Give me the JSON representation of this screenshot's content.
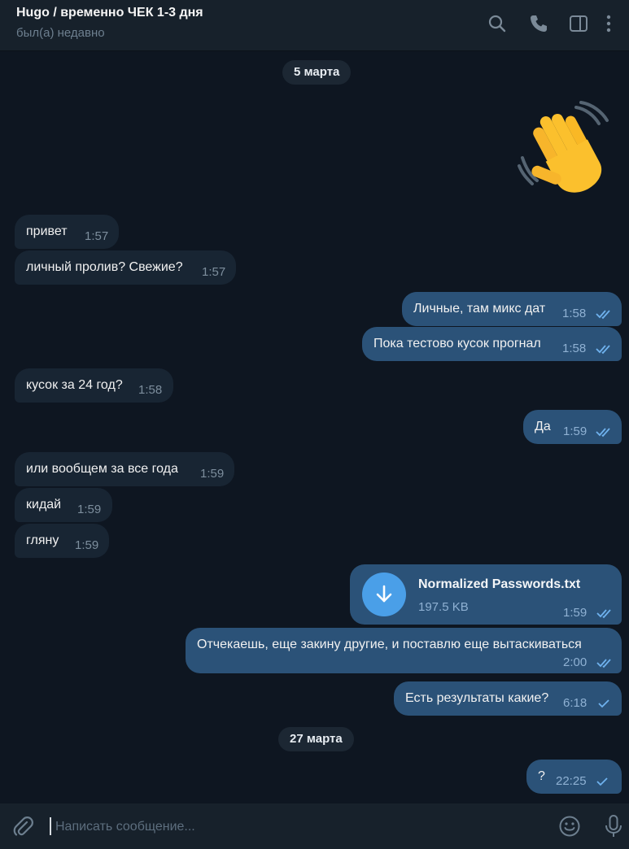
{
  "header": {
    "title": "Hugo / временно ЧЕК 1-3 дня",
    "status": "был(а) недавно",
    "icons": [
      "search-icon",
      "phone-icon",
      "sidebar-toggle-icon",
      "more-vertical-icon"
    ]
  },
  "dates": [
    "5 марта",
    "27 марта"
  ],
  "sticker": {
    "emoji": "👋",
    "name": "waving-hand"
  },
  "messages": [
    {
      "dir": "in",
      "text": "привет",
      "time": "1:57"
    },
    {
      "dir": "in",
      "text": "личный пролив? Свежие?",
      "time": "1:57"
    },
    {
      "dir": "out",
      "text": "Личные, там микс дат",
      "time": "1:58",
      "read": true
    },
    {
      "dir": "out",
      "text": "Пока тестово кусок прогнал",
      "time": "1:58",
      "read": true
    },
    {
      "dir": "in",
      "text": "кусок за 24 год?",
      "time": "1:58"
    },
    {
      "dir": "out",
      "text": "Да",
      "time": "1:59",
      "read": true
    },
    {
      "dir": "in",
      "text": "или вообщем за все года",
      "time": "1:59"
    },
    {
      "dir": "in",
      "text": "кидай",
      "time": "1:59"
    },
    {
      "dir": "in",
      "text": "гляну",
      "time": "1:59"
    },
    {
      "dir": "out",
      "type": "file",
      "file_name": "Normalized Passwords.txt",
      "file_size": "197.5 KB",
      "time": "1:59",
      "read": true
    },
    {
      "dir": "out",
      "text": "Отчекаешь, еще закину другие, и поставлю еще вытаскиваться",
      "time": "2:00",
      "read": true
    },
    {
      "dir": "out",
      "text": "Есть результаты какие?",
      "time": "6:18",
      "read": false
    },
    {
      "dir": "out",
      "text": "?",
      "time": "22:25",
      "read": false
    }
  ],
  "composer": {
    "placeholder": "Написать сообщение...",
    "value": ""
  },
  "colors": {
    "background": "#0e1621",
    "header": "#17212b",
    "incoming_bubble": "#182533",
    "outgoing_bubble": "#2b5278",
    "accent": "#4a9fe8",
    "check": "#6fb2ee"
  }
}
